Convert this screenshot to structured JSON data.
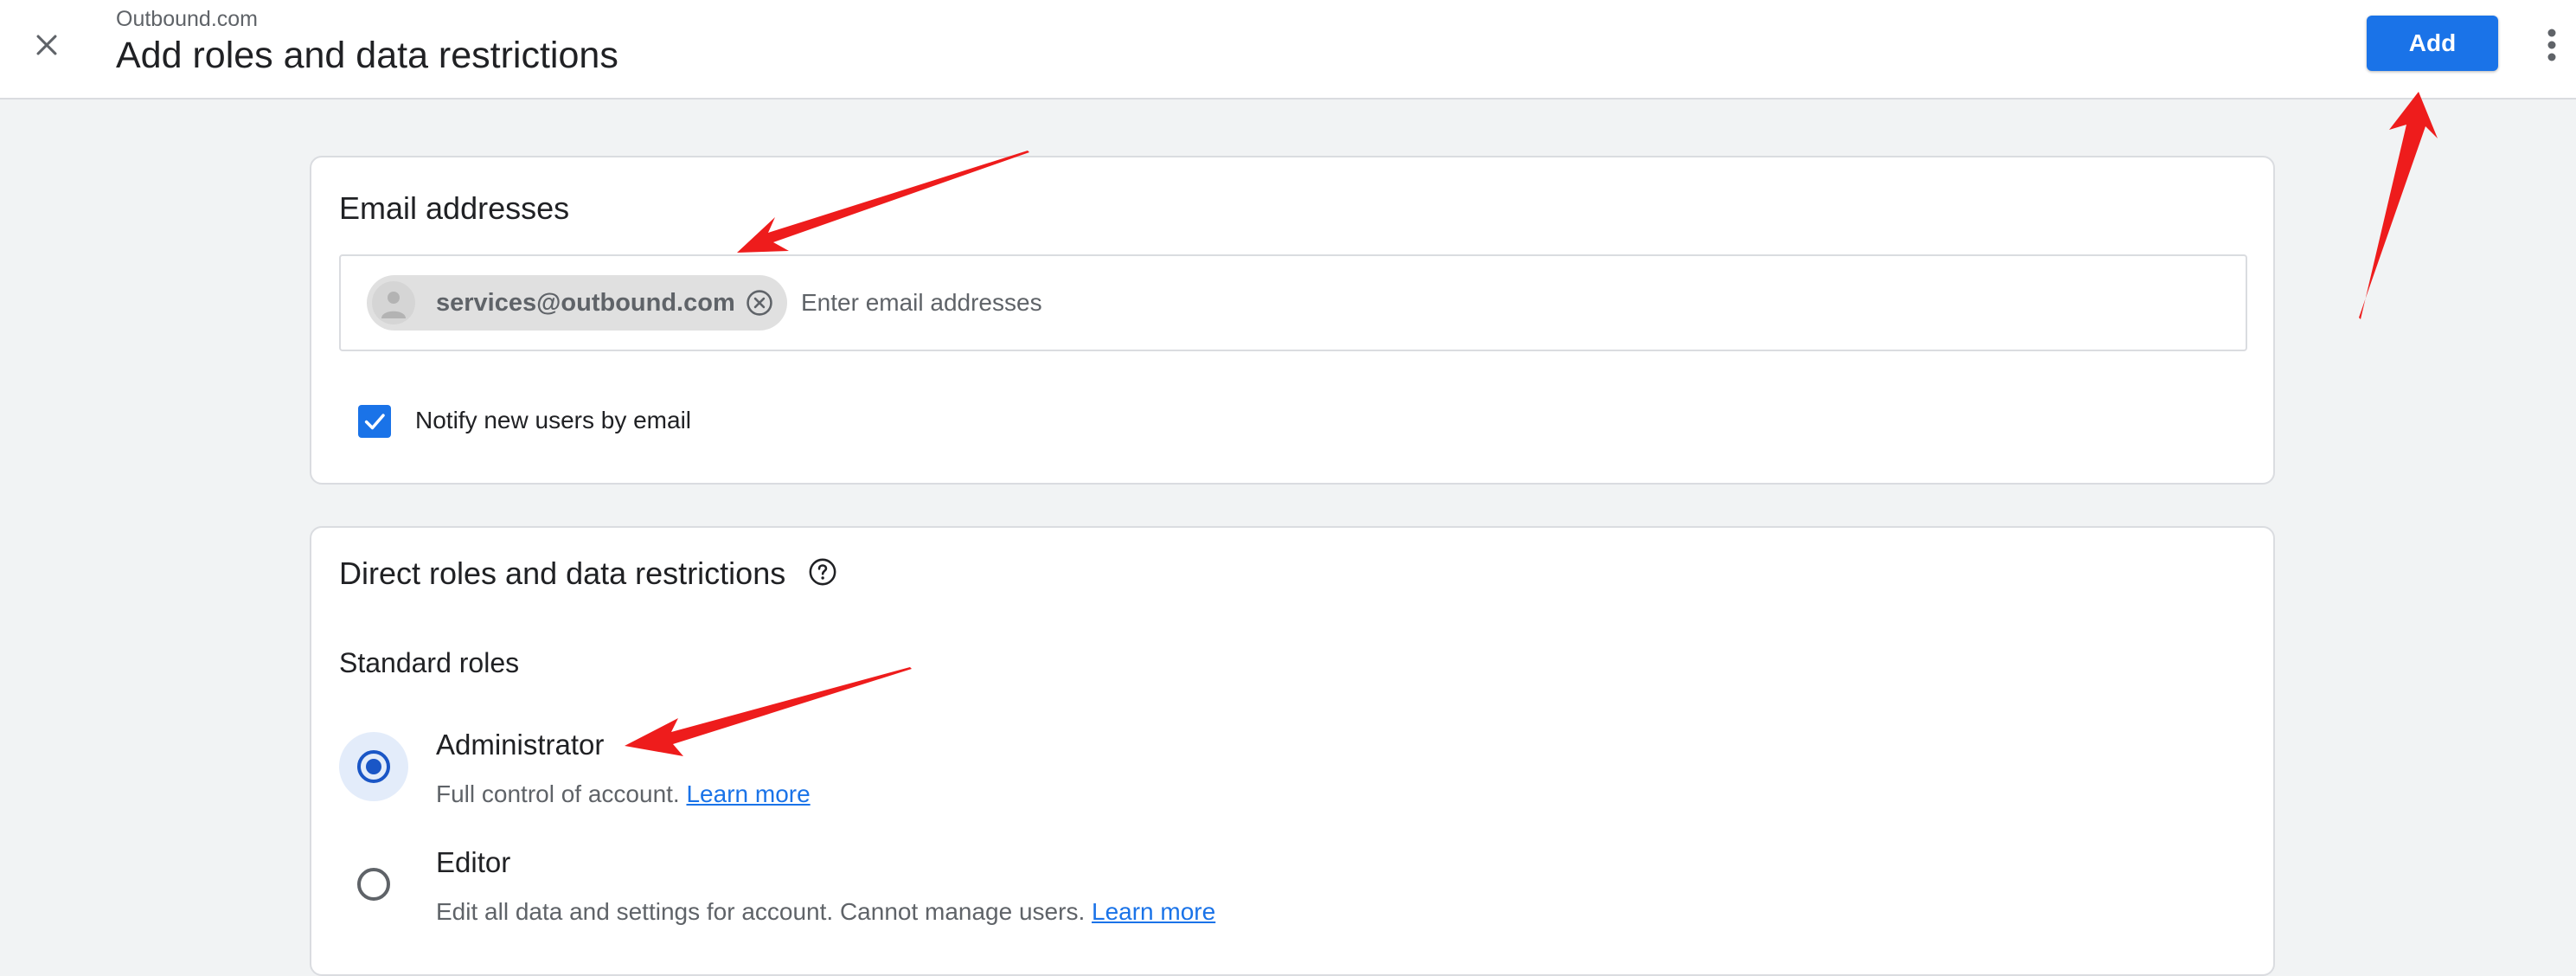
{
  "header": {
    "breadcrumb": "Outbound.com",
    "title": "Add roles and data restrictions",
    "add_label": "Add"
  },
  "email_section": {
    "heading": "Email addresses",
    "chip_email": "services@outbound.com",
    "input_placeholder": "Enter email addresses",
    "notify_label": "Notify new users by email",
    "notify_checked": true
  },
  "roles_section": {
    "heading": "Direct roles and data restrictions",
    "subheading": "Standard roles",
    "roles": [
      {
        "title": "Administrator",
        "description": "Full control of account.",
        "link": "Learn more",
        "selected": true
      },
      {
        "title": "Editor",
        "description": "Edit all data and settings for account. Cannot manage users.",
        "link": "Learn more",
        "selected": false
      }
    ]
  },
  "colors": {
    "accent": "#1a73e8",
    "annotation_arrow": "#ee1c1c"
  }
}
